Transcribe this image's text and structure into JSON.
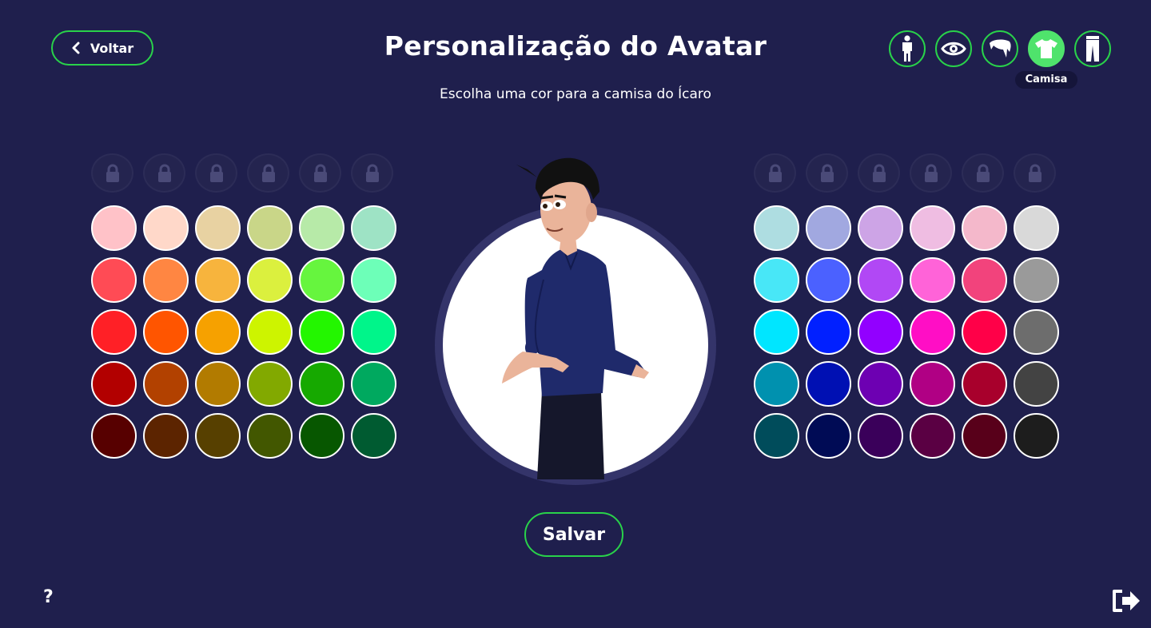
{
  "header": {
    "back_label": "Voltar",
    "title": "Personalização do Avatar",
    "subtitle": "Escolha uma cor para a camisa do Ícaro"
  },
  "categories": [
    {
      "name": "body",
      "icon": "body-icon"
    },
    {
      "name": "eyes",
      "icon": "eye-icon"
    },
    {
      "name": "hair",
      "icon": "hair-icon"
    },
    {
      "name": "shirt",
      "icon": "shirt-icon",
      "active": true,
      "tooltip": "Camisa"
    },
    {
      "name": "pants",
      "icon": "pants-icon"
    }
  ],
  "tooltip": "Camisa",
  "palette_left": {
    "locked_slots": 6,
    "rows": [
      [
        "#ffc2c8",
        "#ffd8c9",
        "#e8d2a2",
        "#c9d688",
        "#b7eaa8",
        "#9ee3c5"
      ],
      [
        "#ff4b55",
        "#ff8642",
        "#f7b43d",
        "#dbf03e",
        "#66f53e",
        "#6dffb8"
      ],
      [
        "#ff2026",
        "#ff5500",
        "#f6a100",
        "#cdf400",
        "#23f600",
        "#00f58a"
      ],
      [
        "#b20000",
        "#b24100",
        "#b27b00",
        "#82a900",
        "#16a900",
        "#00a95f"
      ],
      [
        "#570000",
        "#5c2400",
        "#574000",
        "#425700",
        "#075700",
        "#005b31"
      ]
    ]
  },
  "palette_right": {
    "locked_slots": 6,
    "rows": [
      [
        "#aedde1",
        "#a1a8e0",
        "#cda4e6",
        "#efbde2",
        "#f4b8cb",
        "#d9d9d9"
      ],
      [
        "#48e7f7",
        "#4b61ff",
        "#b148f5",
        "#ff63d8",
        "#f2437c",
        "#9a9a9a"
      ],
      [
        "#00e6ff",
        "#0120ff",
        "#9200ff",
        "#ff0ec5",
        "#ff0048",
        "#6d6d6d"
      ],
      [
        "#0091af",
        "#0010b3",
        "#6d00b2",
        "#b00084",
        "#a8002c",
        "#434343"
      ],
      [
        "#004c5b",
        "#000b55",
        "#3a005a",
        "#5a0043",
        "#58001a",
        "#1d1d1d"
      ]
    ]
  },
  "save_label": "Salvar",
  "help_label": "?",
  "colors": {
    "background": "#1f1f4d",
    "accent": "#29d24a",
    "active_category": "#4fe36c",
    "shirt_color": "#1f2a6b"
  }
}
